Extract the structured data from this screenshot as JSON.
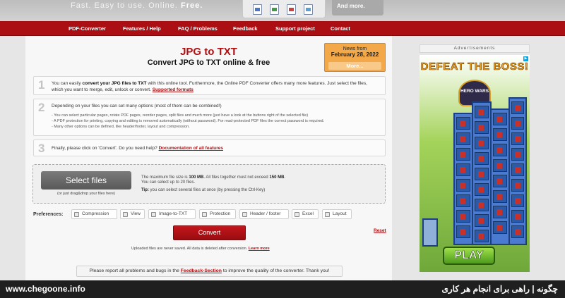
{
  "header": {
    "tagline": "Fast. Easy to use. Online. ",
    "tagline_bold": "Free.",
    "more_label": "And more."
  },
  "nav": {
    "items": [
      "PDF-Converter",
      "Features / Help",
      "FAQ / Problems",
      "Feedback",
      "Support project",
      "Contact"
    ]
  },
  "main": {
    "title": "JPG to TXT",
    "subtitle": "Convert JPG to TXT online & free",
    "news": {
      "label": "News from",
      "date": "February 28, 2022",
      "more": "More..."
    },
    "step1": {
      "number": "1",
      "pre": "You can easily ",
      "bold": "convert your JPG files to TXT",
      "post": " with this online tool. Furthermore, the Online PDF Converter offers many more features. Just select the files, which you want to merge, edit, unlock or convert. ",
      "link": "Supported formats"
    },
    "step2": {
      "number": "2",
      "text": "Depending on your files you can set many options (most of them can be combined!)",
      "bullets": [
        "- You can select particular pages, rotate PDF pages, reorder pages, split files and much more (just have a look at the buttons right of the selected file)",
        "- A PDF protection for printing, copying and editing is removed automatically (without password). For read-protected PDF files the correct password is required.",
        "- Many other options can be defined, like header/footer, layout and compression."
      ]
    },
    "step3": {
      "number": "3",
      "text": "Finally, please click on 'Convert'. Do you need help? ",
      "link": "Documentation of all features"
    },
    "upload": {
      "button": "Select files",
      "hint": "(or just drag&drop your files here)",
      "info1_pre": "The maximum file size is ",
      "info1_b1": "100 MB",
      "info1_mid": ". All files together must not exceed ",
      "info1_b2": "150 MB",
      "info1_post": ".",
      "info2": "You can select up to 20 files.",
      "tip_label": "Tip:",
      "tip_text": " you can select several files at once (by pressing the Ctrl-Key)"
    },
    "preferences": {
      "label": "Preferences:",
      "items": [
        "Compression",
        "View",
        "Image-to-TXT",
        "Protection",
        "Header / footer",
        "Excel",
        "Layout"
      ]
    },
    "convert_label": "Convert",
    "reset_label": "Reset",
    "notice": {
      "text": "Uploaded files are never saved. All data is deleted after conversion. ",
      "link": "Learn more"
    },
    "report": {
      "pre": "Please report all problems and bugs in the ",
      "link": "Feedback-Section",
      "post": " to improve the quality of the converter. Thank you!"
    }
  },
  "ad": {
    "label": "Advertisements",
    "title": "DEFEAT THE BOSS!",
    "logo": "HERO WARS",
    "play": "PLAY"
  },
  "footer": {
    "site": "www.chegoone.info",
    "persian": "چگونه | راهی برای انجام هر کاری"
  },
  "colors": {
    "brand_red": "#ab0f14",
    "news_orange": "#f3a94a",
    "footer": "#1f1f1f"
  }
}
